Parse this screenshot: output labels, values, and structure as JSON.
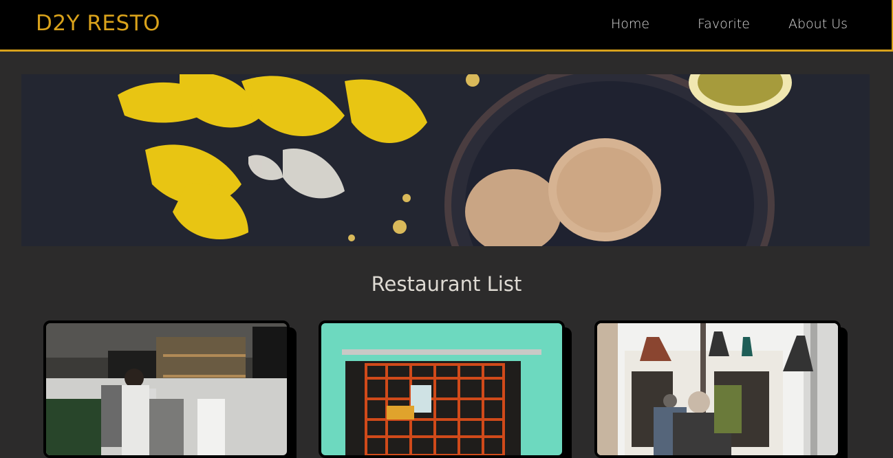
{
  "header": {
    "brand": "D2Y RESTO",
    "nav": {
      "home": "Home",
      "favorite": "Favorite",
      "about": "About Us"
    }
  },
  "colors": {
    "accent": "#d9a21b",
    "background": "#2c2b2b",
    "navbar": "#000000"
  },
  "main": {
    "section_title": "Restaurant List"
  }
}
